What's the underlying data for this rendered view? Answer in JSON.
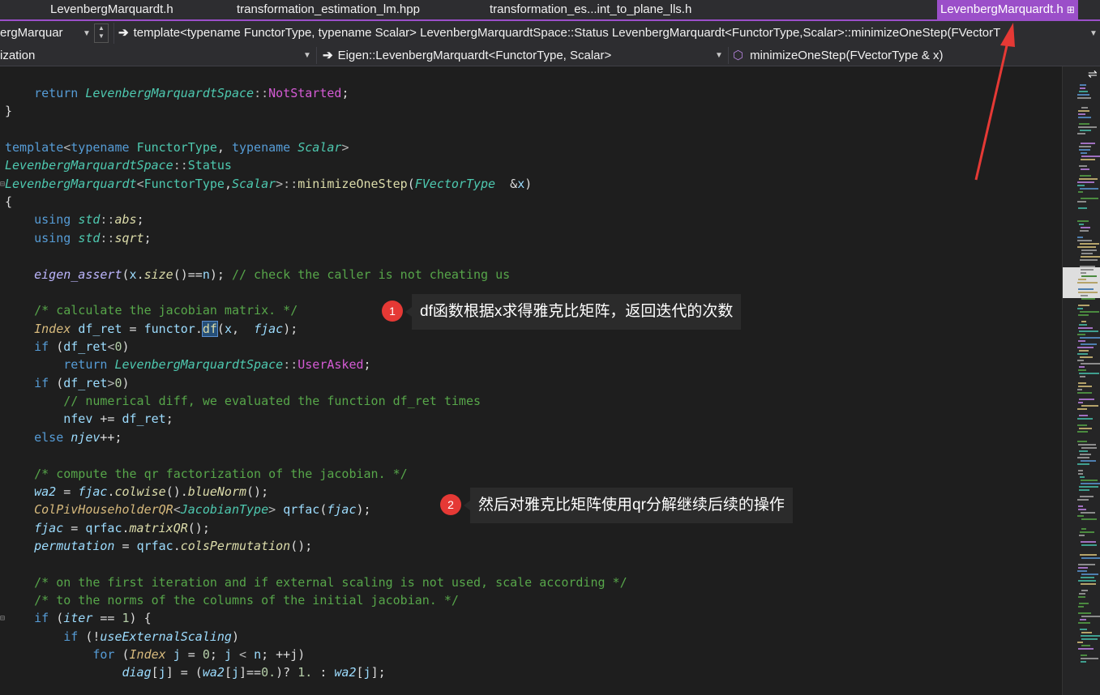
{
  "tabs": [
    {
      "label": "LevenbergMarquardt.h",
      "active": false
    },
    {
      "label": "transformation_estimation_lm.hpp",
      "active": false
    },
    {
      "label": "transformation_es...int_to_plane_lls.h",
      "active": false
    },
    {
      "label": "LevenbergMarquardt.h",
      "active": true
    }
  ],
  "nav": {
    "file_box": "ergMarquar",
    "signature": "template<typename FunctorType, typename Scalar> LevenbergMarquardtSpace::Status LevenbergMarquardt<FunctorType,Scalar>::minimizeOneStep(FVectorT",
    "scope_box": "ization",
    "class_box": "Eigen::LevenbergMarquardt<FunctorType, Scalar>",
    "member_box": "minimizeOneStep(FVectorType & x)"
  },
  "annotations": [
    {
      "number": "1",
      "text": "df函数根据x求得雅克比矩阵，返回迭代的次数"
    },
    {
      "number": "2",
      "text": "然后对雅克比矩阵使用qr分解继续后续的操作"
    }
  ],
  "colors": {
    "accent": "#9b4fc9",
    "badge": "#e53935",
    "arrow": "#e53935"
  },
  "code": {
    "l0": {
      "a": "return",
      "b": "LevenbergMarquardtSpace",
      "c": "::",
      "d": "NotStarted",
      "e": ";"
    },
    "l1": {
      "a": "}"
    },
    "l2": {
      "a": "template",
      "b": "<",
      "c": "typename",
      "d": "FunctorType",
      "e": ",",
      "f": "typename",
      "g": "Scalar",
      "h": ">"
    },
    "l3": {
      "a": "LevenbergMarquardtSpace",
      "b": "::",
      "c": "Status"
    },
    "l4": {
      "a": "LevenbergMarquardt",
      "b": "<",
      "c": "FunctorType",
      "d": ",",
      "e": "Scalar",
      "f": ">::",
      "g": "minimizeOneStep",
      "h": "(",
      "i": "FVectorType",
      "j": "  &",
      "k": "x",
      "l": ")"
    },
    "l5": {
      "a": "{"
    },
    "l6": {
      "a": "using",
      "b": "std",
      "c": "::",
      "d": "abs",
      "e": ";"
    },
    "l7": {
      "a": "using",
      "b": "std",
      "c": "::",
      "d": "sqrt",
      "e": ";"
    },
    "l8": {
      "a": "eigen_assert",
      "b": "(",
      "c": "x",
      "d": ".",
      "e": "size",
      "f": "()==",
      "g": "n",
      "h": ");",
      "i": "// check the caller is not cheating us"
    },
    "l9": {
      "a": "/* calculate the jacobian matrix. */"
    },
    "l10": {
      "a": "Index",
      "b": "df_ret",
      "c": "=",
      "d": "functor",
      "e": ".",
      "f": "df",
      "g": "(",
      "h": "x",
      "i": ",",
      "j": "fjac",
      "k": ");"
    },
    "l11": {
      "a": "if",
      "b": "(",
      "c": "df_ret",
      "d": "<",
      "e": "0",
      "f": ")"
    },
    "l12": {
      "a": "return",
      "b": "LevenbergMarquardtSpace",
      "c": "::",
      "d": "UserAsked",
      "e": ";"
    },
    "l13": {
      "a": "if",
      "b": "(",
      "c": "df_ret",
      "d": ">",
      "e": "0",
      "f": ")"
    },
    "l14": {
      "a": "// numerical diff, we evaluated the function df_ret times"
    },
    "l15": {
      "a": "nfev",
      "b": "+=",
      "c": "df_ret",
      "d": ";"
    },
    "l16": {
      "a": "else",
      "b": "njev",
      "c": "++;"
    },
    "l17": {
      "a": "/* compute the qr factorization of the jacobian. */"
    },
    "l18": {
      "a": "wa2",
      "b": "=",
      "c": "fjac",
      "d": ".",
      "e": "colwise",
      "f": "().",
      "g": "blueNorm",
      "h": "();"
    },
    "l19": {
      "a": "ColPivHouseholderQR",
      "b": "<",
      "c": "JacobianType",
      "d": ">",
      "e": "qrfac",
      "f": "(",
      "g": "fjac",
      "h": ");"
    },
    "l20": {
      "a": "fjac",
      "b": "=",
      "c": "qrfac",
      "d": ".",
      "e": "matrixQR",
      "f": "();"
    },
    "l21": {
      "a": "permutation",
      "b": "=",
      "c": "qrfac",
      "d": ".",
      "e": "colsPermutation",
      "f": "();"
    },
    "l22": {
      "a": "/* on the first iteration and if external scaling is not used, scale according */"
    },
    "l23": {
      "a": "/* to the norms of the columns of the initial jacobian. */"
    },
    "l24": {
      "a": "if",
      "b": "(",
      "c": "iter",
      "d": "==",
      "e": "1",
      "f": ") {"
    },
    "l25": {
      "a": "if",
      "b": "(!",
      "c": "useExternalScaling",
      "d": ")"
    },
    "l26": {
      "a": "for",
      "b": "(",
      "c": "Index",
      "d": "j",
      "e": "=",
      "f": "0",
      "g": ";",
      "h": "j",
      "i": "<",
      "j": "n",
      "k": ";",
      "l": "++j",
      "m": ")"
    },
    "l27": {
      "a": "diag",
      "b": "[",
      "c": "j",
      "d": "] = (",
      "e": "wa2",
      "f": "[",
      "g": "j",
      "h": "]==",
      "i": "0.",
      "j": ")?",
      "k": "1.",
      "l": ":",
      "m": "wa2",
      "n": "[",
      "o": "j",
      "p": "];"
    }
  }
}
